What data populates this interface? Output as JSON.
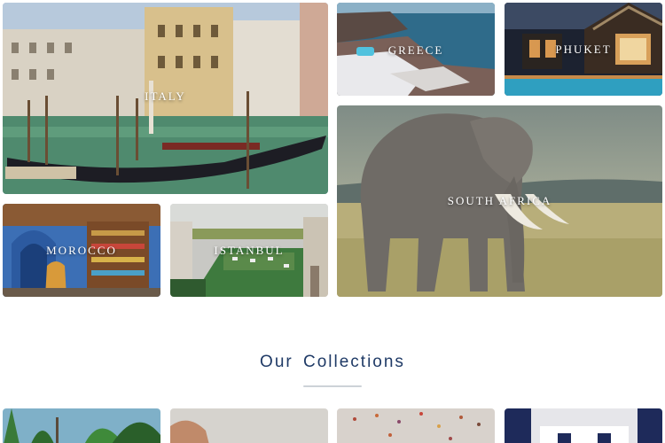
{
  "destinations": [
    {
      "label": "ITALY",
      "icon": "venice-gondola-image"
    },
    {
      "label": "GREECE",
      "icon": "santorini-cliff-image"
    },
    {
      "label": "PHUKET",
      "icon": "resort-pool-night-image"
    },
    {
      "label": "SOUTH AFRICA",
      "icon": "elephant-savanna-image"
    },
    {
      "label": "MOROCCO",
      "icon": "market-bazaar-image"
    },
    {
      "label": "ISTANBUL",
      "icon": "courtyard-garden-image"
    }
  ],
  "collections_section": {
    "title": "Our Collections",
    "accent_color": "#1f3a66",
    "cards": [
      {
        "icon": "palm-jungle-image"
      },
      {
        "icon": "hand-gesture-image"
      },
      {
        "icon": "hot-air-balloons-image"
      },
      {
        "icon": "interior-room-image"
      }
    ]
  }
}
